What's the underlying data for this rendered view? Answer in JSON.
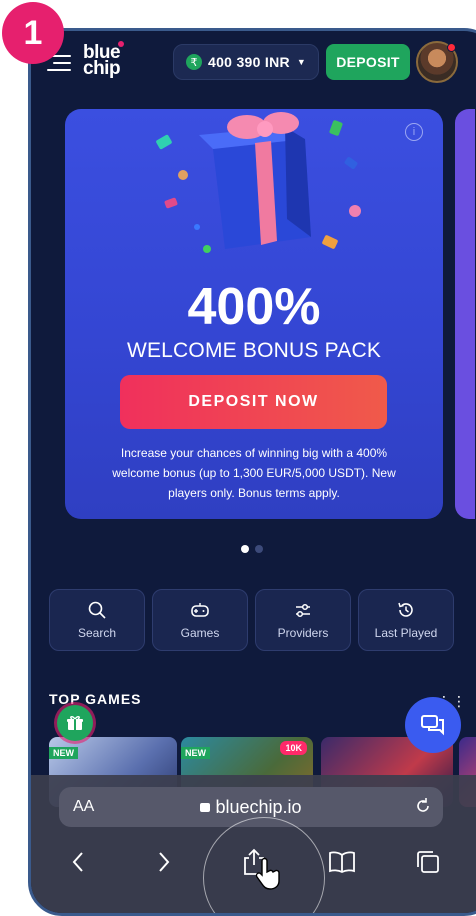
{
  "step_number": "1",
  "header": {
    "logo_line1": "blue",
    "logo_line2": "chip",
    "balance": "400 390 INR",
    "currency_symbol": "₹",
    "deposit_label": "DEPOSIT"
  },
  "banner": {
    "percent": "400%",
    "title": "WELCOME BONUS PACK",
    "cta": "DEPOSIT NOW",
    "description": "Increase your chances of winning big with a 400% welcome bonus (up to 1,300 EUR/5,000 USDT). New players only. Bonus terms apply.",
    "slides_total": 2,
    "active_slide": 1
  },
  "quick_nav": [
    {
      "label": "Search",
      "icon": "search-icon"
    },
    {
      "label": "Games",
      "icon": "gamepad-icon"
    },
    {
      "label": "Providers",
      "icon": "sliders-icon"
    },
    {
      "label": "Last Played",
      "icon": "history-icon"
    }
  ],
  "top_games": {
    "title": "TOP GAMES",
    "tags": {
      "new": "NEW",
      "hot": "10K"
    }
  },
  "browser": {
    "aa_label": "AA",
    "url": "bluechip.io"
  },
  "colors": {
    "background": "#0f1a3c",
    "accent_green": "#1fa55d",
    "banner_blue": "#3b4fe0",
    "cta_pink": "#f0305c",
    "step_badge": "#e6206e"
  }
}
